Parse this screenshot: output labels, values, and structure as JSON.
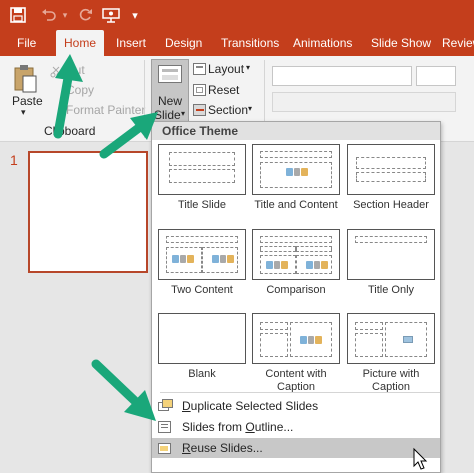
{
  "colors": {
    "brand": "#c43e1c",
    "arrow": "#1aa77a"
  },
  "qat": {
    "icons": [
      "save-icon",
      "undo-icon",
      "redo-icon",
      "present-from-beginning-icon",
      "customize-qat-icon"
    ],
    "customize_glyph": "▾"
  },
  "tabs": [
    {
      "label": "File"
    },
    {
      "label": "Home",
      "active": true
    },
    {
      "label": "Insert"
    },
    {
      "label": "Design"
    },
    {
      "label": "Transitions"
    },
    {
      "label": "Animations"
    },
    {
      "label": "Slide Show"
    },
    {
      "label": "Review"
    }
  ],
  "ribbon": {
    "paste": "Paste",
    "cut": "Cut",
    "copy": "Copy",
    "format_painter": "Format Painter",
    "clipboard_group": "Clipboard",
    "new_slide_1": "New",
    "new_slide_2": "Slide",
    "layout": "Layout",
    "reset": "Reset",
    "section": "Section"
  },
  "slides": {
    "number": "1"
  },
  "gallery": {
    "header": "Office Theme",
    "layouts": [
      {
        "name": "Title Slide"
      },
      {
        "name": "Title and Content"
      },
      {
        "name": "Section Header"
      },
      {
        "name": "Two Content"
      },
      {
        "name": "Comparison"
      },
      {
        "name": "Title Only"
      },
      {
        "name": "Blank"
      },
      {
        "name_1": "Content with",
        "name_2": "Caption"
      },
      {
        "name_1": "Picture with",
        "name_2": "Caption"
      }
    ],
    "commands": [
      {
        "label_pre": "",
        "label_key": "D",
        "label_post": "uplicate Selected Slides"
      },
      {
        "label_pre": "Slides from ",
        "label_key": "O",
        "label_post": "utline..."
      },
      {
        "label_pre": "",
        "label_key": "R",
        "label_post": "euse Slides..."
      }
    ]
  }
}
